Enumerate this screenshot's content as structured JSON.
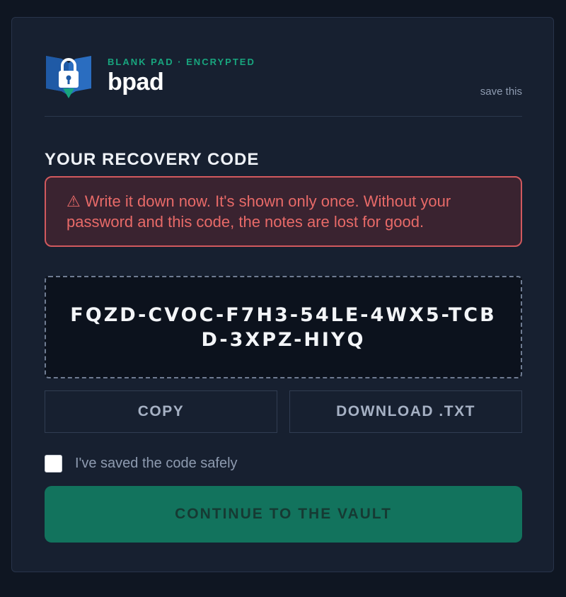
{
  "brand": {
    "subtitle": "BLANK PAD · ENCRYPTED",
    "name": "bpad",
    "save_link": "save this"
  },
  "recovery": {
    "title": "YOUR RECOVERY CODE",
    "warning": "⚠ Write it down now. It's shown only once. Without your password and this code, the notes are lost for good.",
    "code": "FQZD-CVOC-F7H3-54LE-4WX5-TCBD-3XPZ-HIYQ"
  },
  "actions": {
    "copy_label": "COPY",
    "download_label": "DOWNLOAD .TXT",
    "checkbox_label": "I've saved the code safely",
    "checkbox_checked": false,
    "continue_label": "CONTINUE TO THE VAULT"
  },
  "colors": {
    "accent": "#18a57e",
    "warning": "#d1595e",
    "continue_bg": "#12735d",
    "background": "#172030"
  },
  "icons": {
    "logo": "padlock-book-icon"
  }
}
